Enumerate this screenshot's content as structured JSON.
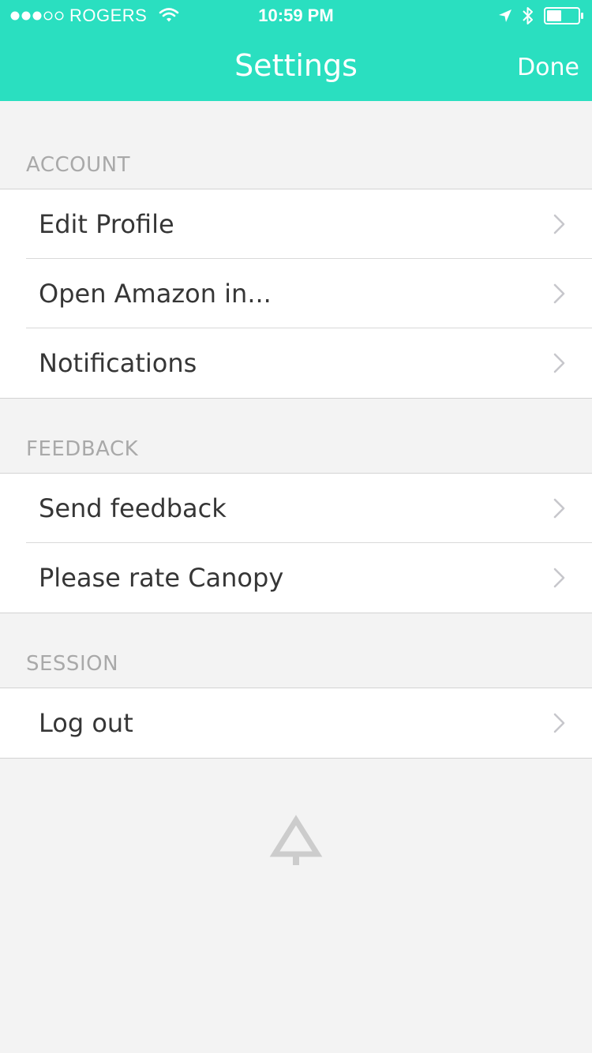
{
  "status_bar": {
    "carrier": "ROGERS",
    "time": "10:59 PM",
    "signal_icon": "signal-dots-icon",
    "wifi_icon": "wifi-icon",
    "location_icon": "location-arrow-icon",
    "bluetooth_icon": "bluetooth-icon",
    "battery_icon": "battery-icon"
  },
  "nav": {
    "title": "Settings",
    "done_label": "Done"
  },
  "sections": {
    "account": {
      "header": "ACCOUNT",
      "items": [
        "Edit Profile",
        "Open Amazon in...",
        "Notifications"
      ]
    },
    "feedback": {
      "header": "FEEDBACK",
      "items": [
        "Send feedback",
        "Please rate Canopy"
      ]
    },
    "session": {
      "header": "SESSION",
      "items": [
        "Log out"
      ]
    }
  },
  "footer": {
    "logo_icon": "canopy-tree-logo-icon"
  },
  "colors": {
    "accent": "#2adfc0",
    "background": "#f3f3f3",
    "row_background": "#ffffff",
    "section_header_text": "#a9a9a9",
    "row_text": "#363636",
    "chevron": "#c7c7cc",
    "logo": "#cccccc"
  }
}
